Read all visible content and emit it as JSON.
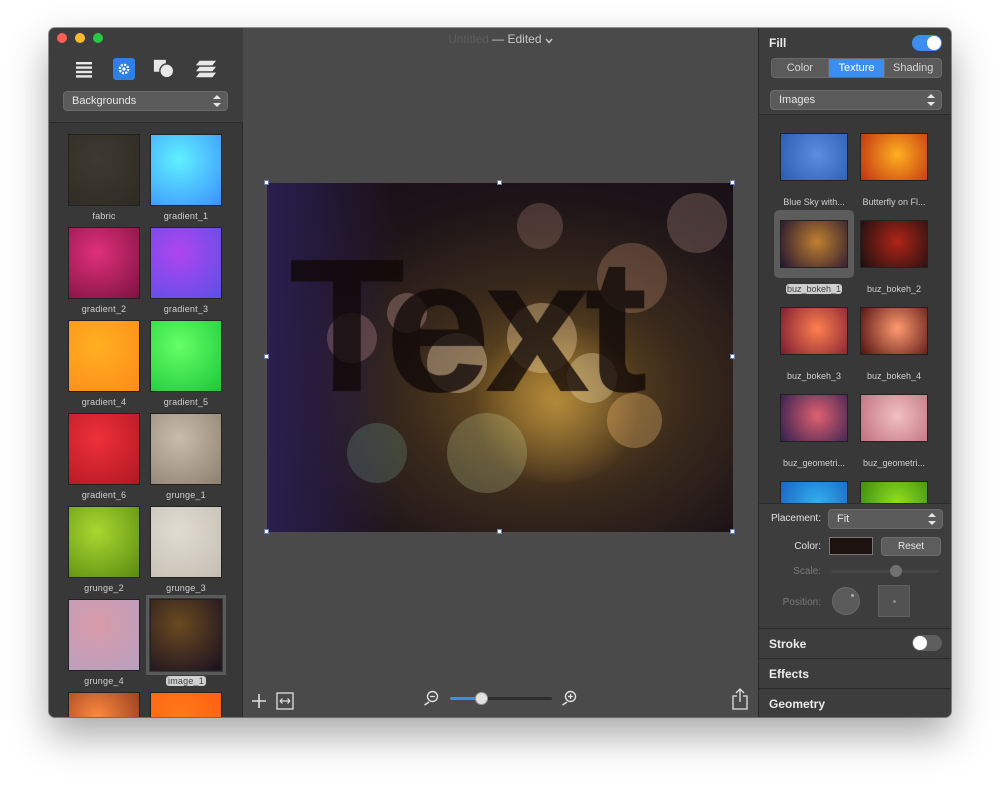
{
  "window": {
    "doc_name": "Untitled",
    "separator": "—",
    "status": "Edited"
  },
  "toolbar": {
    "icons": [
      "list-icon",
      "gear-icon",
      "shapes-icon",
      "layers-icon"
    ],
    "active": "gear-icon"
  },
  "left": {
    "category_popup": "Backgrounds",
    "items": [
      {
        "label": "fabric",
        "colors": [
          "#3e3a30",
          "#2e2b24"
        ]
      },
      {
        "label": "gradient_1",
        "colors": [
          "#5ff0ff",
          "#3c90ff"
        ]
      },
      {
        "label": "gradient_2",
        "colors": [
          "#e0307a",
          "#7c1240"
        ]
      },
      {
        "label": "gradient_3",
        "colors": [
          "#b045f0",
          "#5a50e6"
        ]
      },
      {
        "label": "gradient_4",
        "colors": [
          "#ffb020",
          "#ff8a1a"
        ]
      },
      {
        "label": "gradient_5",
        "colors": [
          "#66ff66",
          "#1cc83a"
        ]
      },
      {
        "label": "gradient_6",
        "colors": [
          "#ee3038",
          "#b01824"
        ]
      },
      {
        "label": "grunge_1",
        "colors": [
          "#c8bcaa",
          "#8e8070"
        ]
      },
      {
        "label": "grunge_2",
        "colors": [
          "#a8d830",
          "#5a8a10"
        ]
      },
      {
        "label": "grunge_3",
        "colors": [
          "#e0dcd2",
          "#c4beb2"
        ]
      },
      {
        "label": "grunge_4",
        "colors": [
          "#d89aa8",
          "#b8a0c0"
        ]
      },
      {
        "label": "image_1",
        "colors": [
          "#6a4a20",
          "#1a1020"
        ],
        "selected": true
      },
      {
        "label": "",
        "colors": [
          "#ff8a40",
          "#803018"
        ]
      },
      {
        "label": "",
        "colors": [
          "#ff7a18",
          "#ff5a10"
        ]
      }
    ]
  },
  "canvas": {
    "text": "Text"
  },
  "zoom": {
    "level": 0.3
  },
  "inspector": {
    "fill": {
      "title": "Fill",
      "enabled": true,
      "tabs": [
        "Color",
        "Texture",
        "Shading"
      ],
      "active_tab": "Texture",
      "source_popup": "Images",
      "textures": [
        {
          "label": "Blue Sky with...",
          "colors": [
            "#5a8ee0",
            "#2a5cb0"
          ]
        },
        {
          "label": "Butterfly on Fl...",
          "colors": [
            "#ffb020",
            "#c03010"
          ]
        },
        {
          "label": "buz_bokeh_1",
          "colors": [
            "#c08030",
            "#221430"
          ],
          "selected": true
        },
        {
          "label": "buz_bokeh_2",
          "colors": [
            "#b02418",
            "#1a1010"
          ]
        },
        {
          "label": "buz_bokeh_3",
          "colors": [
            "#ff8050",
            "#7a1a30"
          ]
        },
        {
          "label": "buz_bokeh_4",
          "colors": [
            "#ff9a70",
            "#501010"
          ]
        },
        {
          "label": "buz_geometri...",
          "colors": [
            "#e06070",
            "#302050"
          ]
        },
        {
          "label": "buz_geometri...",
          "colors": [
            "#f0c0c0",
            "#c07080"
          ]
        },
        {
          "label": "",
          "colors": [
            "#30b0f0",
            "#1a60c0"
          ]
        },
        {
          "label": "",
          "colors": [
            "#90e020",
            "#3a8a10"
          ]
        }
      ],
      "placement_label": "Placement:",
      "placement_value": "Fit",
      "color_label": "Color:",
      "color_value": "#1e1210",
      "reset_label": "Reset",
      "scale_label": "Scale:",
      "scale_value": 0.6,
      "position_label": "Position:"
    },
    "stroke": {
      "title": "Stroke",
      "enabled": false
    },
    "effects": {
      "title": "Effects"
    },
    "geometry": {
      "title": "Geometry"
    }
  },
  "colors": {
    "accent": "#3b8ef0",
    "window_bg": "#4a4a4a",
    "panel_bg": "#3d3d3d"
  }
}
